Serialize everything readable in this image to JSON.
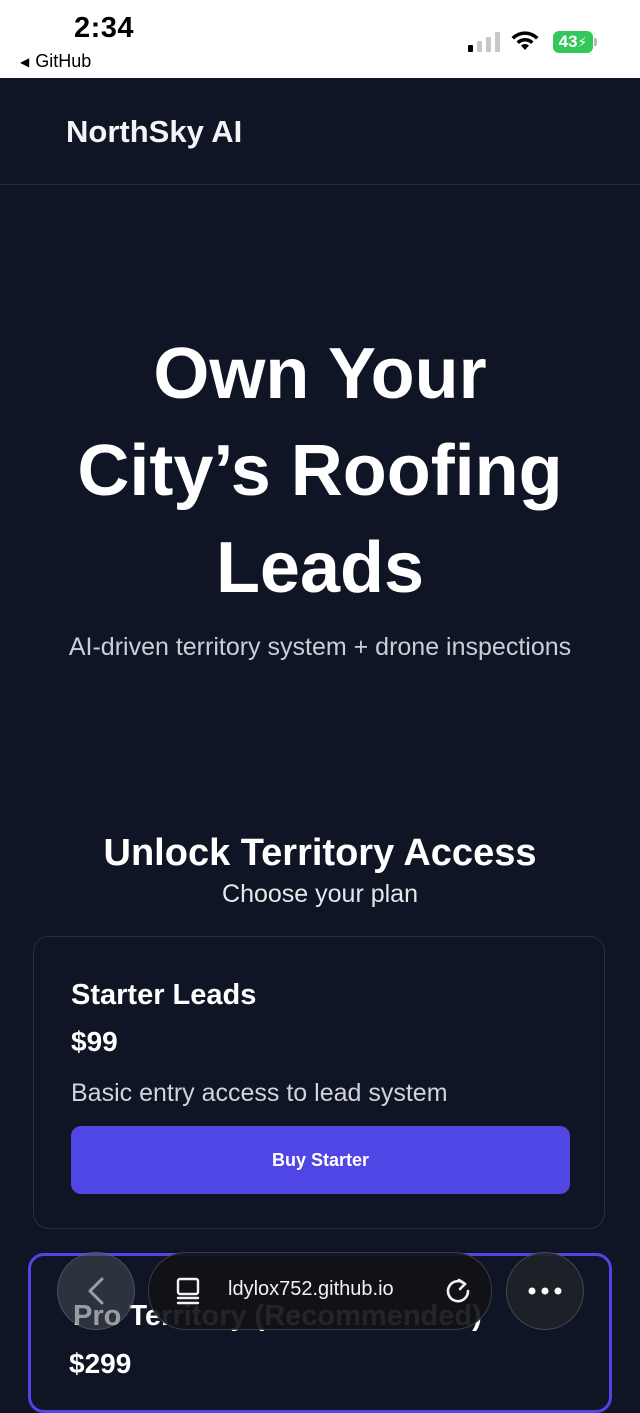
{
  "status_bar": {
    "time": "2:34",
    "back_app": "GitHub",
    "battery": "43"
  },
  "header": {
    "brand": "NorthSky AI"
  },
  "hero": {
    "title_line1": "Own Your",
    "title_line2": "City’s Roofing",
    "title_line3": "Leads",
    "subtitle": "AI-driven territory system + drone inspections"
  },
  "pricing": {
    "title": "Unlock Territory Access",
    "subtitle": "Choose your plan",
    "plans": [
      {
        "name": "Starter Leads",
        "price": "$99",
        "description": "Basic entry access to lead system",
        "button": "Buy Starter"
      },
      {
        "name": "Pro Territory (Recommended)",
        "price": "$299"
      }
    ]
  },
  "browser": {
    "url": "ldylox752.github.io"
  },
  "colors": {
    "background": "#0f1524",
    "accent": "#4f46e5",
    "battery": "#34c759"
  }
}
